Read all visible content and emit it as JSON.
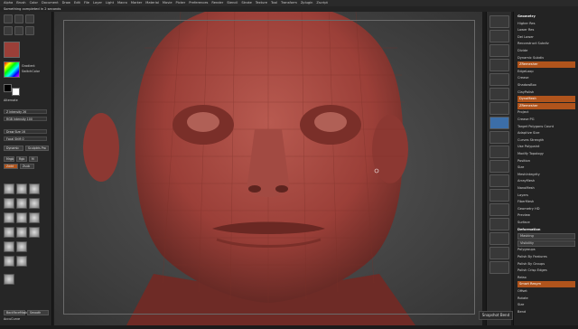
{
  "menubar": [
    "Alpha",
    "Brush",
    "Color",
    "Document",
    "Draw",
    "Edit",
    "File",
    "Layer",
    "Light",
    "Macro",
    "Marker",
    "Material",
    "Movie",
    "Picker",
    "Preferences",
    "Render",
    "Stencil",
    "Stroke",
    "Texture",
    "Tool",
    "Transform",
    "Zplugin",
    "Zscript"
  ],
  "status_message": "Something completed in 2 seconds",
  "left": {
    "intensity_label": "Z Intensity 26",
    "rgb_label": "RGB Intensity 100",
    "gradient_label": "Gradient",
    "switch_label": "SwitchColor",
    "alternate_label": "Alternate",
    "draw_size": "Draw Size 16",
    "focal_shift": "Focal Shift 0",
    "dynamic": "Dynamic",
    "sculptris": "Sculptris Pro",
    "mrgb": "Mrgb",
    "rgb": "Rgb",
    "m": "M",
    "zadd": "Zadd",
    "zsub": "Zsub",
    "backface": "BackFaceMask",
    "angle": "AngleMask",
    "accucurve": "AccuCurve",
    "smooth": "Smooth"
  },
  "right_tray": {
    "rows": [
      "Geometry",
      "Higher Res",
      "Lower Res",
      "Del Lower",
      "Reconstruct Subdiv",
      "Divide",
      "Dynamic Subdiv",
      "ZRemesher",
      "EdgeLoop",
      "Crease",
      "ShadowBox",
      "ClayPolish",
      "DynaMesh",
      "ZRemesher",
      "Project",
      "Crease PG",
      "Target Polygons Count",
      "Adaptive Size",
      "Curves Strength",
      "Use Polypaint",
      "Modify Topology",
      "Position",
      "Size",
      "MeshIntegrity",
      "ArrayMesh",
      "NanoMesh",
      "Layers",
      "FiberMesh",
      "Geometry HD",
      "Preview",
      "Surface",
      "Deformation",
      "Masking",
      "Visibility",
      "Polygroups",
      "Polish By Features",
      "Polish By Groups",
      "Polish Crisp Edges",
      "Relax",
      "Smart Resym",
      "Offset",
      "Rotate",
      "Size",
      "Bend"
    ],
    "values": {
      "ZRemesher": "",
      "Adaptive Size": "50",
      "Curves Strength": "50"
    },
    "sdiv": "SDiv 1"
  },
  "shelf_icons": [
    "scroll-icon",
    "zoom-icon",
    "actual-icon",
    "aahalf-icon",
    "persp-icon",
    "floor-icon",
    "local-icon",
    "xyz-icon",
    "frame-icon",
    "move-icon",
    "scale-icon",
    "rotate-icon",
    "linefill-icon",
    "polyf-icon",
    "transp-icon",
    "ghost-icon",
    "solo-icon",
    "xpose-icon"
  ],
  "colors": {
    "accent": "#b0541c",
    "active": "#3c6ea8",
    "skin": "#9b3f38"
  },
  "snapshot_label": "Snapshot Bend",
  "canvas": {
    "description": ""
  }
}
